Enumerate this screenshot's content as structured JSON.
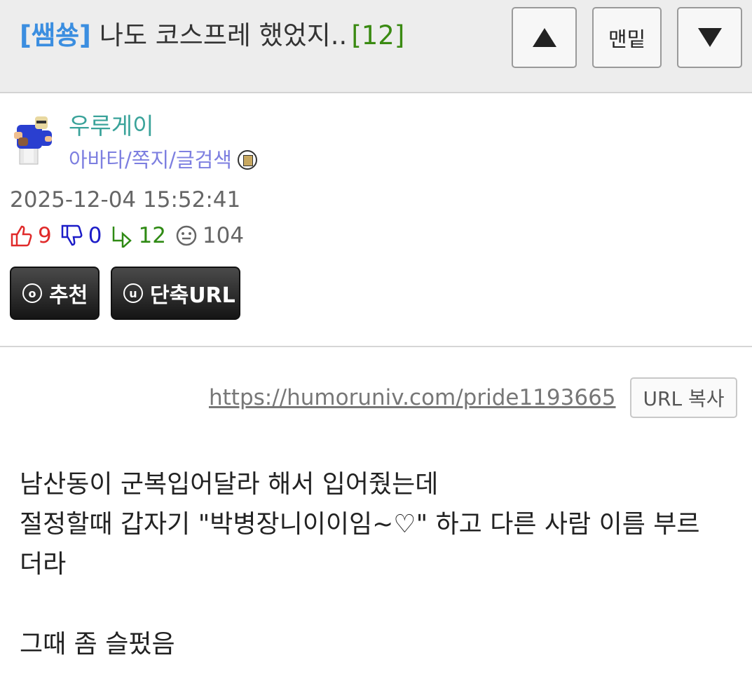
{
  "header": {
    "category": "[쌤쑝]",
    "subject": "나도 코스프레 했었지..",
    "reply_count": "[12]",
    "nav_up_icon": "triangle-up-icon",
    "nav_bottom_label": "맨밑",
    "nav_down_icon": "triangle-down-icon"
  },
  "author": {
    "name": "우루게이",
    "links": "아바타/쪽지/글검색",
    "avatar_icon": "pixel-avatar-icon",
    "level_icon": "level-badge-icon"
  },
  "post": {
    "date": "2025-12-04 15:52:41",
    "likes": "9",
    "dislikes": "0",
    "replies": "12",
    "views": "104"
  },
  "actions": {
    "recommend_icon_char": "o",
    "recommend_label": "추천",
    "short_url_icon_char": "u",
    "short_url_label": "단축URL"
  },
  "url_row": {
    "url": "https://humoruniv.com/pride1193665",
    "copy_label": "URL 복사"
  },
  "body": {
    "line1": "남산동이 군복입어달라 해서 입어줬는데",
    "line2": "절정할때 갑자기 \"박병장니이이임~♡\" 하고 다른 사람 이름 부르",
    "line3": "더라",
    "line4": "그때 좀 슬펐음"
  },
  "colors": {
    "category": "#3b8ee0",
    "reply_count": "#3a8a12",
    "author": "#3aa39a",
    "author_links": "#7d7fe0",
    "like": "#e02a2a",
    "dislike": "#1c1cc8",
    "reply": "#2f8a14"
  }
}
